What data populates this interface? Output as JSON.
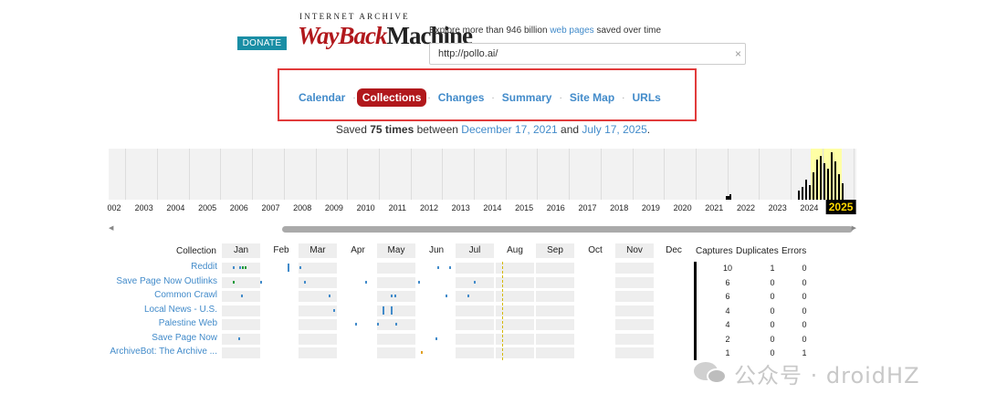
{
  "header": {
    "donate_label": "DONATE",
    "logo_top": "INTERNET ARCHIVE",
    "logo_wayback": "WayBack",
    "logo_machine": "Machine",
    "explore_prefix": "Explore more than 946 billion ",
    "explore_link": "web pages",
    "explore_suffix": " saved over time",
    "url_value": "http://pollo.ai/",
    "clear_icon": "×"
  },
  "nav": {
    "tabs": [
      "Calendar",
      "Collections",
      "Changes",
      "Summary",
      "Site Map",
      "URLs"
    ],
    "active": "Collections",
    "separator": "·"
  },
  "saved": {
    "prefix": "Saved ",
    "count": "75 times",
    "between": " between ",
    "start": "December 17, 2021",
    "and": " and ",
    "end": "July 17, 2025",
    "period": "."
  },
  "timeline": {
    "years": [
      "002",
      "2003",
      "2004",
      "2005",
      "2006",
      "2007",
      "2008",
      "2009",
      "2010",
      "2011",
      "2012",
      "2013",
      "2014",
      "2015",
      "2016",
      "2017",
      "2018",
      "2019",
      "2020",
      "2021",
      "2022",
      "2023",
      "2024",
      "2025"
    ],
    "current_year": "2025",
    "highlight_color": "#ffffa5"
  },
  "collections": {
    "header_label": "Collection",
    "months": [
      "Jan",
      "Feb",
      "Mar",
      "Apr",
      "May",
      "Jun",
      "Jul",
      "Aug",
      "Sep",
      "Oct",
      "Nov",
      "Dec"
    ],
    "columns": [
      "Captures",
      "Duplicates",
      "Errors"
    ],
    "rows": [
      {
        "name": "Reddit",
        "captures": "10",
        "duplicates": "1",
        "errors": "0"
      },
      {
        "name": "Save Page Now Outlinks",
        "captures": "6",
        "duplicates": "0",
        "errors": "0"
      },
      {
        "name": "Common Crawl",
        "captures": "6",
        "duplicates": "0",
        "errors": "0"
      },
      {
        "name": "Local News - U.S.",
        "captures": "4",
        "duplicates": "0",
        "errors": "0"
      },
      {
        "name": "Palestine Web",
        "captures": "4",
        "duplicates": "0",
        "errors": "0"
      },
      {
        "name": "Save Page Now",
        "captures": "2",
        "duplicates": "0",
        "errors": "0"
      },
      {
        "name": "ArchiveBot: The Archive ...",
        "captures": "1",
        "duplicates": "0",
        "errors": "1"
      }
    ]
  },
  "watermark": {
    "text": "公众号 · droidHZ",
    "icon": "wechat-icon"
  }
}
